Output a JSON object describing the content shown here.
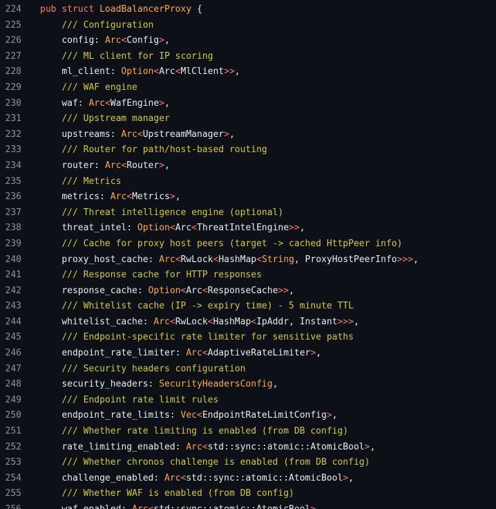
{
  "colors": {
    "background": "#0d1117",
    "line_number": "#8b949e",
    "text": "#e6edf3",
    "keyword": "#ff7b72",
    "type": "#ffa657",
    "comment": "#d5c74a"
  },
  "editor": {
    "lines": [
      {
        "number": "224",
        "indent": "",
        "tokens": [
          [
            "kw",
            "pub"
          ],
          [
            "pl",
            " "
          ],
          [
            "kw",
            "struct"
          ],
          [
            "pl",
            " "
          ],
          [
            "ty",
            "LoadBalancerProxy"
          ],
          [
            "pl",
            " {"
          ]
        ]
      },
      {
        "number": "225",
        "indent": "    ",
        "tokens": [
          [
            "cm",
            "/// Configuration"
          ]
        ]
      },
      {
        "number": "226",
        "indent": "    ",
        "tokens": [
          [
            "pl",
            "config: "
          ],
          [
            "ty",
            "Arc"
          ],
          [
            "op",
            "<"
          ],
          [
            "pl",
            "Config"
          ],
          [
            "op",
            ">"
          ],
          [
            "pl",
            ","
          ]
        ]
      },
      {
        "number": "227",
        "indent": "    ",
        "tokens": [
          [
            "cm",
            "/// ML client for IP scoring"
          ]
        ]
      },
      {
        "number": "228",
        "indent": "    ",
        "tokens": [
          [
            "pl",
            "ml_client: "
          ],
          [
            "ty",
            "Option"
          ],
          [
            "op",
            "<"
          ],
          [
            "pl",
            "Arc"
          ],
          [
            "op",
            "<"
          ],
          [
            "pl",
            "MlClient"
          ],
          [
            "op",
            ">>"
          ],
          [
            "pl",
            ","
          ]
        ]
      },
      {
        "number": "229",
        "indent": "    ",
        "tokens": [
          [
            "cm",
            "/// WAF engine"
          ]
        ]
      },
      {
        "number": "230",
        "indent": "    ",
        "tokens": [
          [
            "pl",
            "waf: "
          ],
          [
            "ty",
            "Arc"
          ],
          [
            "op",
            "<"
          ],
          [
            "pl",
            "WafEngine"
          ],
          [
            "op",
            ">"
          ],
          [
            "pl",
            ","
          ]
        ]
      },
      {
        "number": "231",
        "indent": "    ",
        "tokens": [
          [
            "cm",
            "/// Upstream manager"
          ]
        ]
      },
      {
        "number": "232",
        "indent": "    ",
        "tokens": [
          [
            "pl",
            "upstreams: "
          ],
          [
            "ty",
            "Arc"
          ],
          [
            "op",
            "<"
          ],
          [
            "pl",
            "UpstreamManager"
          ],
          [
            "op",
            ">"
          ],
          [
            "pl",
            ","
          ]
        ]
      },
      {
        "number": "233",
        "indent": "    ",
        "tokens": [
          [
            "cm",
            "/// Router for path/host-based routing"
          ]
        ]
      },
      {
        "number": "234",
        "indent": "    ",
        "tokens": [
          [
            "pl",
            "router: "
          ],
          [
            "ty",
            "Arc"
          ],
          [
            "op",
            "<"
          ],
          [
            "pl",
            "Router"
          ],
          [
            "op",
            ">"
          ],
          [
            "pl",
            ","
          ]
        ]
      },
      {
        "number": "235",
        "indent": "    ",
        "tokens": [
          [
            "cm",
            "/// Metrics"
          ]
        ]
      },
      {
        "number": "236",
        "indent": "    ",
        "tokens": [
          [
            "pl",
            "metrics: "
          ],
          [
            "ty",
            "Arc"
          ],
          [
            "op",
            "<"
          ],
          [
            "pl",
            "Metrics"
          ],
          [
            "op",
            ">"
          ],
          [
            "pl",
            ","
          ]
        ]
      },
      {
        "number": "237",
        "indent": "    ",
        "tokens": [
          [
            "cm",
            "/// Threat intelligence engine (optional)"
          ]
        ]
      },
      {
        "number": "238",
        "indent": "    ",
        "tokens": [
          [
            "pl",
            "threat_intel: "
          ],
          [
            "ty",
            "Option"
          ],
          [
            "op",
            "<"
          ],
          [
            "pl",
            "Arc"
          ],
          [
            "op",
            "<"
          ],
          [
            "pl",
            "ThreatIntelEngine"
          ],
          [
            "op",
            ">>"
          ],
          [
            "pl",
            ","
          ]
        ]
      },
      {
        "number": "239",
        "indent": "    ",
        "tokens": [
          [
            "cm",
            "/// Cache for proxy host peers (target -> cached HttpPeer info)"
          ]
        ]
      },
      {
        "number": "240",
        "indent": "    ",
        "tokens": [
          [
            "pl",
            "proxy_host_cache: "
          ],
          [
            "ty",
            "Arc"
          ],
          [
            "op",
            "<"
          ],
          [
            "pl",
            "RwLock"
          ],
          [
            "op",
            "<"
          ],
          [
            "pl",
            "HashMap"
          ],
          [
            "op",
            "<"
          ],
          [
            "ty",
            "String"
          ],
          [
            "pl",
            ", ProxyHostPeerInfo"
          ],
          [
            "op",
            ">>>"
          ],
          [
            "pl",
            ","
          ]
        ]
      },
      {
        "number": "241",
        "indent": "    ",
        "tokens": [
          [
            "cm",
            "/// Response cache for HTTP responses"
          ]
        ]
      },
      {
        "number": "242",
        "indent": "    ",
        "tokens": [
          [
            "pl",
            "response_cache: "
          ],
          [
            "ty",
            "Option"
          ],
          [
            "op",
            "<"
          ],
          [
            "pl",
            "Arc"
          ],
          [
            "op",
            "<"
          ],
          [
            "pl",
            "ResponseCache"
          ],
          [
            "op",
            ">>"
          ],
          [
            "pl",
            ","
          ]
        ]
      },
      {
        "number": "243",
        "indent": "    ",
        "tokens": [
          [
            "cm",
            "/// Whitelist cache (IP -> expiry time) - 5 minute TTL"
          ]
        ]
      },
      {
        "number": "244",
        "indent": "    ",
        "tokens": [
          [
            "pl",
            "whitelist_cache: "
          ],
          [
            "ty",
            "Arc"
          ],
          [
            "op",
            "<"
          ],
          [
            "pl",
            "RwLock"
          ],
          [
            "op",
            "<"
          ],
          [
            "pl",
            "HashMap"
          ],
          [
            "op",
            "<"
          ],
          [
            "pl",
            "IpAddr, Instant"
          ],
          [
            "op",
            ">>>"
          ],
          [
            "pl",
            ","
          ]
        ]
      },
      {
        "number": "245",
        "indent": "    ",
        "tokens": [
          [
            "cm",
            "/// Endpoint-specific rate limiter for sensitive paths"
          ]
        ]
      },
      {
        "number": "246",
        "indent": "    ",
        "tokens": [
          [
            "pl",
            "endpoint_rate_limiter: "
          ],
          [
            "ty",
            "Arc"
          ],
          [
            "op",
            "<"
          ],
          [
            "pl",
            "AdaptiveRateLimiter"
          ],
          [
            "op",
            ">"
          ],
          [
            "pl",
            ","
          ]
        ]
      },
      {
        "number": "247",
        "indent": "    ",
        "tokens": [
          [
            "cm",
            "/// Security headers configuration"
          ]
        ]
      },
      {
        "number": "248",
        "indent": "    ",
        "tokens": [
          [
            "pl",
            "security_headers: "
          ],
          [
            "ty",
            "SecurityHeadersConfig"
          ],
          [
            "pl",
            ","
          ]
        ]
      },
      {
        "number": "249",
        "indent": "    ",
        "tokens": [
          [
            "cm",
            "/// Endpoint rate limit rules"
          ]
        ]
      },
      {
        "number": "250",
        "indent": "    ",
        "tokens": [
          [
            "pl",
            "endpoint_rate_limits: "
          ],
          [
            "ty",
            "Vec"
          ],
          [
            "op",
            "<"
          ],
          [
            "pl",
            "EndpointRateLimitConfig"
          ],
          [
            "op",
            ">"
          ],
          [
            "pl",
            ","
          ]
        ]
      },
      {
        "number": "251",
        "indent": "    ",
        "tokens": [
          [
            "cm",
            "/// Whether rate limiting is enabled (from DB config)"
          ]
        ]
      },
      {
        "number": "252",
        "indent": "    ",
        "tokens": [
          [
            "pl",
            "rate_limiting_enabled: "
          ],
          [
            "ty",
            "Arc"
          ],
          [
            "op",
            "<"
          ],
          [
            "pl",
            "std::sync::atomic::AtomicBool"
          ],
          [
            "op",
            ">"
          ],
          [
            "pl",
            ","
          ]
        ]
      },
      {
        "number": "253",
        "indent": "    ",
        "tokens": [
          [
            "cm",
            "/// Whether chronos challenge is enabled (from DB config)"
          ]
        ]
      },
      {
        "number": "254",
        "indent": "    ",
        "tokens": [
          [
            "pl",
            "challenge_enabled: "
          ],
          [
            "ty",
            "Arc"
          ],
          [
            "op",
            "<"
          ],
          [
            "pl",
            "std::sync::atomic::AtomicBool"
          ],
          [
            "op",
            ">"
          ],
          [
            "pl",
            ","
          ]
        ]
      },
      {
        "number": "255",
        "indent": "    ",
        "tokens": [
          [
            "cm",
            "/// Whether WAF is enabled (from DB config)"
          ]
        ]
      },
      {
        "number": "256",
        "indent": "    ",
        "tokens": [
          [
            "pl",
            "waf_enabled: "
          ],
          [
            "ty",
            "Arc"
          ],
          [
            "op",
            "<"
          ],
          [
            "pl",
            "std::sync::atomic::AtomicBool"
          ],
          [
            "op",
            ">"
          ]
        ]
      }
    ]
  }
}
